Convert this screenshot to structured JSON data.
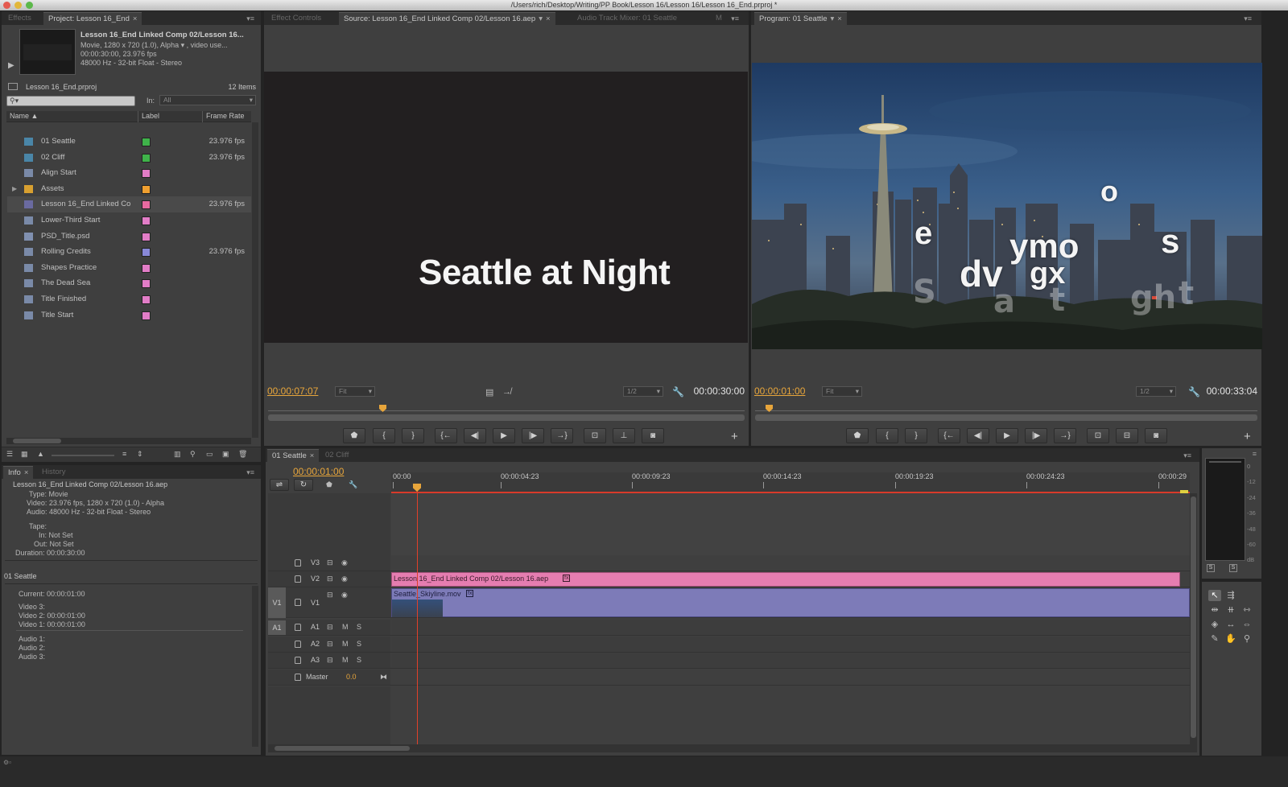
{
  "window": {
    "title": "/Users/rich/Desktop/Writing/PP Book/Lesson 16/Lesson 16/Lesson 16_End.prproj *"
  },
  "project_panel": {
    "tabs": [
      {
        "label": "Effects"
      },
      {
        "label": "Project: Lesson 16_End"
      }
    ],
    "preview": {
      "name": "Lesson 16_End Linked Comp 02/Lesson 16...",
      "line1": "Movie, 1280 x 720 (1.0), Alpha ▾ , video use...",
      "line2": "00:00:30:00, 23.976 fps",
      "line3": "48000 Hz - 32-bit Float - Stereo"
    },
    "project_file": "Lesson 16_End.prproj",
    "item_count": "12 Items",
    "search_placeholder": "",
    "in_label": "In:",
    "in_value": "All",
    "columns": {
      "name": "Name",
      "label": "Label",
      "frame_rate": "Frame Rate"
    },
    "items": [
      {
        "name": "01 Seattle",
        "type": "sequence",
        "color": "#3fb34a",
        "fps": "23.976 fps"
      },
      {
        "name": "02 Cliff",
        "type": "sequence",
        "color": "#3fb34a",
        "fps": "23.976 fps"
      },
      {
        "name": "Align Start",
        "type": "title",
        "color": "#e27dc7",
        "fps": ""
      },
      {
        "name": "Assets",
        "type": "bin",
        "color": "#f0a030",
        "fps": ""
      },
      {
        "name": "Lesson 16_End Linked Co",
        "type": "comp",
        "color": "#e86aa0",
        "fps": "23.976 fps"
      },
      {
        "name": "Lower-Third Start",
        "type": "title",
        "color": "#e27dc7",
        "fps": ""
      },
      {
        "name": "PSD_Title.psd",
        "type": "still",
        "color": "#e27dc7",
        "fps": ""
      },
      {
        "name": "Rolling Credits",
        "type": "title",
        "color": "#8888d8",
        "fps": "23.976 fps"
      },
      {
        "name": "Shapes Practice",
        "type": "title",
        "color": "#e27dc7",
        "fps": ""
      },
      {
        "name": "The Dead Sea",
        "type": "title",
        "color": "#e27dc7",
        "fps": ""
      },
      {
        "name": "Title Finished",
        "type": "title",
        "color": "#e27dc7",
        "fps": ""
      },
      {
        "name": "Title Start",
        "type": "title",
        "color": "#e27dc7",
        "fps": ""
      }
    ]
  },
  "source_monitor": {
    "tabs": [
      {
        "label": "Effect Controls"
      },
      {
        "label": "Source: Lesson 16_End Linked Comp 02/Lesson 16.aep"
      },
      {
        "label": "Audio Track Mixer: 01 Seattle"
      },
      {
        "label": "M"
      }
    ],
    "frame_text": "Seattle at Night",
    "timecode": "00:00:07:07",
    "zoom": "Fit",
    "resolution": "1/2",
    "duration": "00:00:30:00"
  },
  "program_monitor": {
    "tabs": [
      {
        "label": "Program: 01 Seattle"
      }
    ],
    "timecode": "00:00:01:00",
    "zoom": "Fit",
    "resolution": "1/2",
    "duration": "00:00:33:04",
    "overlay_letters": [
      "e",
      "dv",
      "ymo",
      "gx",
      "o",
      "s"
    ]
  },
  "info_panel": {
    "tabs": [
      {
        "label": "Info"
      },
      {
        "label": "History"
      }
    ],
    "clip_name": "Lesson 16_End Linked Comp 02/Lesson 16.aep",
    "type": "Type:  Movie",
    "video": "Video:  23.976 fps, 1280 x 720 (1.0) - Alpha",
    "audio": "Audio:  48000 Hz - 32-bit Float - Stereo",
    "tape": "Tape:",
    "in": "In:  Not Set",
    "out": "Out:  Not Set",
    "duration": "Duration:  00:00:30:00",
    "sequence": "01 Seattle",
    "current": "Current:  00:00:01:00",
    "video3": "Video 3:",
    "video2": "Video 2:  00:00:01:00",
    "video1": "Video 1:  00:00:01:00",
    "audio1": "Audio 1:",
    "audio2": "Audio 2:",
    "audio3": "Audio 3:"
  },
  "timeline": {
    "tabs": [
      {
        "label": "01 Seattle"
      },
      {
        "label": "02 Cliff"
      }
    ],
    "timecode": "00:00:01:00",
    "ruler": [
      "00:00",
      "00:00:04:23",
      "00:00:09:23",
      "00:00:14:23",
      "00:00:19:23",
      "00:00:24:23",
      "00:00:29"
    ],
    "tracks": {
      "v3": "V3",
      "v2": "V2",
      "v1": "V1",
      "v1_src": "V1",
      "a1": "A1",
      "a1_src": "A1",
      "a2": "A2",
      "a3": "A3",
      "master": "Master",
      "master_value": "0.0",
      "m": "M",
      "s": "S"
    },
    "clips": {
      "v2": "Lesson 16_End Linked Comp 02/Lesson 16.aep",
      "v1": "Seattle_Skiyline.mov",
      "fx": "fx"
    }
  },
  "audio_meter": {
    "scale": [
      "0",
      "-12",
      "-24",
      "-36",
      "-48",
      "-60",
      "dB"
    ],
    "solo_labels": [
      "S",
      "S"
    ]
  },
  "colors": {
    "accent_timecode": "#e7a53b",
    "v2_clip": "#e57db0",
    "v1_clip": "#7d7bb8",
    "playhead": "#e0402a"
  }
}
